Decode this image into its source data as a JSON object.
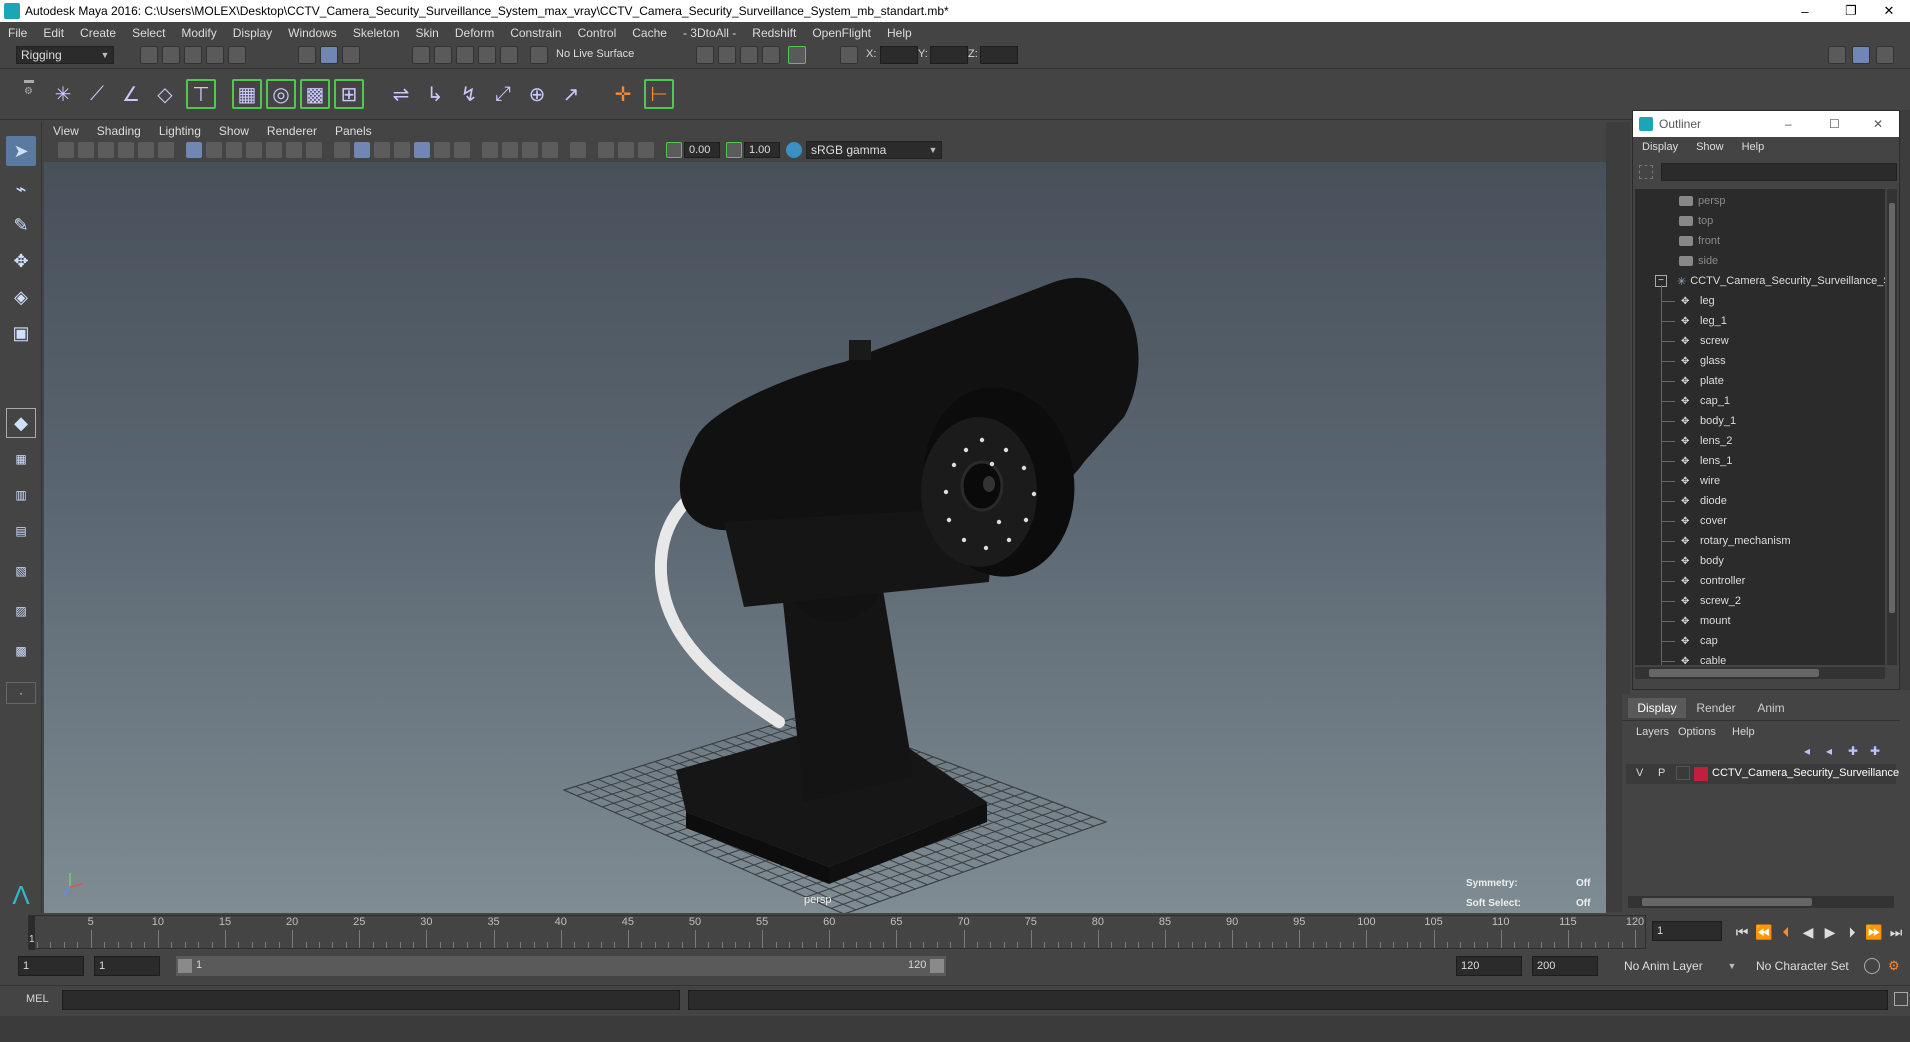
{
  "window": {
    "title": "Autodesk Maya 2016: C:\\Users\\MOLEX\\Desktop\\CCTV_Camera_Security_Surveillance_System_max_vray\\CCTV_Camera_Security_Surveillance_System_mb_standart.mb*",
    "minimize": "–",
    "restore": "❐",
    "close": "✕"
  },
  "menubar": [
    "File",
    "Edit",
    "Create",
    "Select",
    "Modify",
    "Display",
    "Windows",
    "Skeleton",
    "Skin",
    "Deform",
    "Constrain",
    "Control",
    "Cache",
    "- 3DtoAll -",
    "Redshift",
    "OpenFlight",
    "Help"
  ],
  "statusline": {
    "mode": "Rigging",
    "live_surface": "No Live Surface",
    "x_label": "X:",
    "y_label": "Y:",
    "z_label": "Z:"
  },
  "viewport": {
    "menus": [
      "View",
      "Shading",
      "Lighting",
      "Show",
      "Renderer",
      "Panels"
    ],
    "exposure": "0.00",
    "gamma": "1.00",
    "color_space": "sRGB gamma",
    "camera_label": "persp",
    "symmetry_label": "Symmetry:",
    "symmetry_value": "Off",
    "soft_select_label": "Soft Select:",
    "soft_select_value": "Off"
  },
  "outliner": {
    "title": "Outliner",
    "menus": [
      "Display",
      "Show",
      "Help"
    ],
    "cameras": [
      "persp",
      "top",
      "front",
      "side"
    ],
    "group": "CCTV_Camera_Security_Surveillance_S",
    "children": [
      "leg",
      "leg_1",
      "screw",
      "glass",
      "plate",
      "cap_1",
      "body_1",
      "lens_2",
      "lens_1",
      "wire",
      "diode",
      "cover",
      "rotary_mechanism",
      "body",
      "controller",
      "screw_2",
      "mount",
      "cap",
      "cable"
    ]
  },
  "layer_editor": {
    "tabs": [
      "Display",
      "Render",
      "Anim"
    ],
    "menus": [
      "Layers",
      "Options",
      "Help"
    ],
    "layer": {
      "v": "V",
      "p": "P",
      "name": "CCTV_Camera_Security_Surveillance",
      "color": "#c0203a"
    }
  },
  "timeline": {
    "labels": [
      "5",
      "10",
      "15",
      "20",
      "25",
      "30",
      "35",
      "40",
      "45",
      "50",
      "55",
      "60",
      "65",
      "70",
      "75",
      "80",
      "85",
      "90",
      "95",
      "100",
      "105",
      "110",
      "115",
      "120"
    ],
    "start_marker": "1",
    "current_frame": "1"
  },
  "range": {
    "start": "1",
    "playback_start": "1",
    "slider_start": "1",
    "slider_end": "120",
    "playback_end": "120",
    "end": "200",
    "anim_layer": "No Anim Layer",
    "character_set": "No Character Set"
  },
  "cmdline": {
    "label": "MEL"
  },
  "colors": {
    "accent": "#5b7aa0",
    "panel": "#444444",
    "field": "#2b2b2b"
  },
  "icons": {
    "playback": [
      "first-frame-icon",
      "step-back-key-icon",
      "step-back-icon",
      "play-back-icon",
      "play-forward-icon",
      "step-forward-icon",
      "last-frame-icon"
    ]
  }
}
